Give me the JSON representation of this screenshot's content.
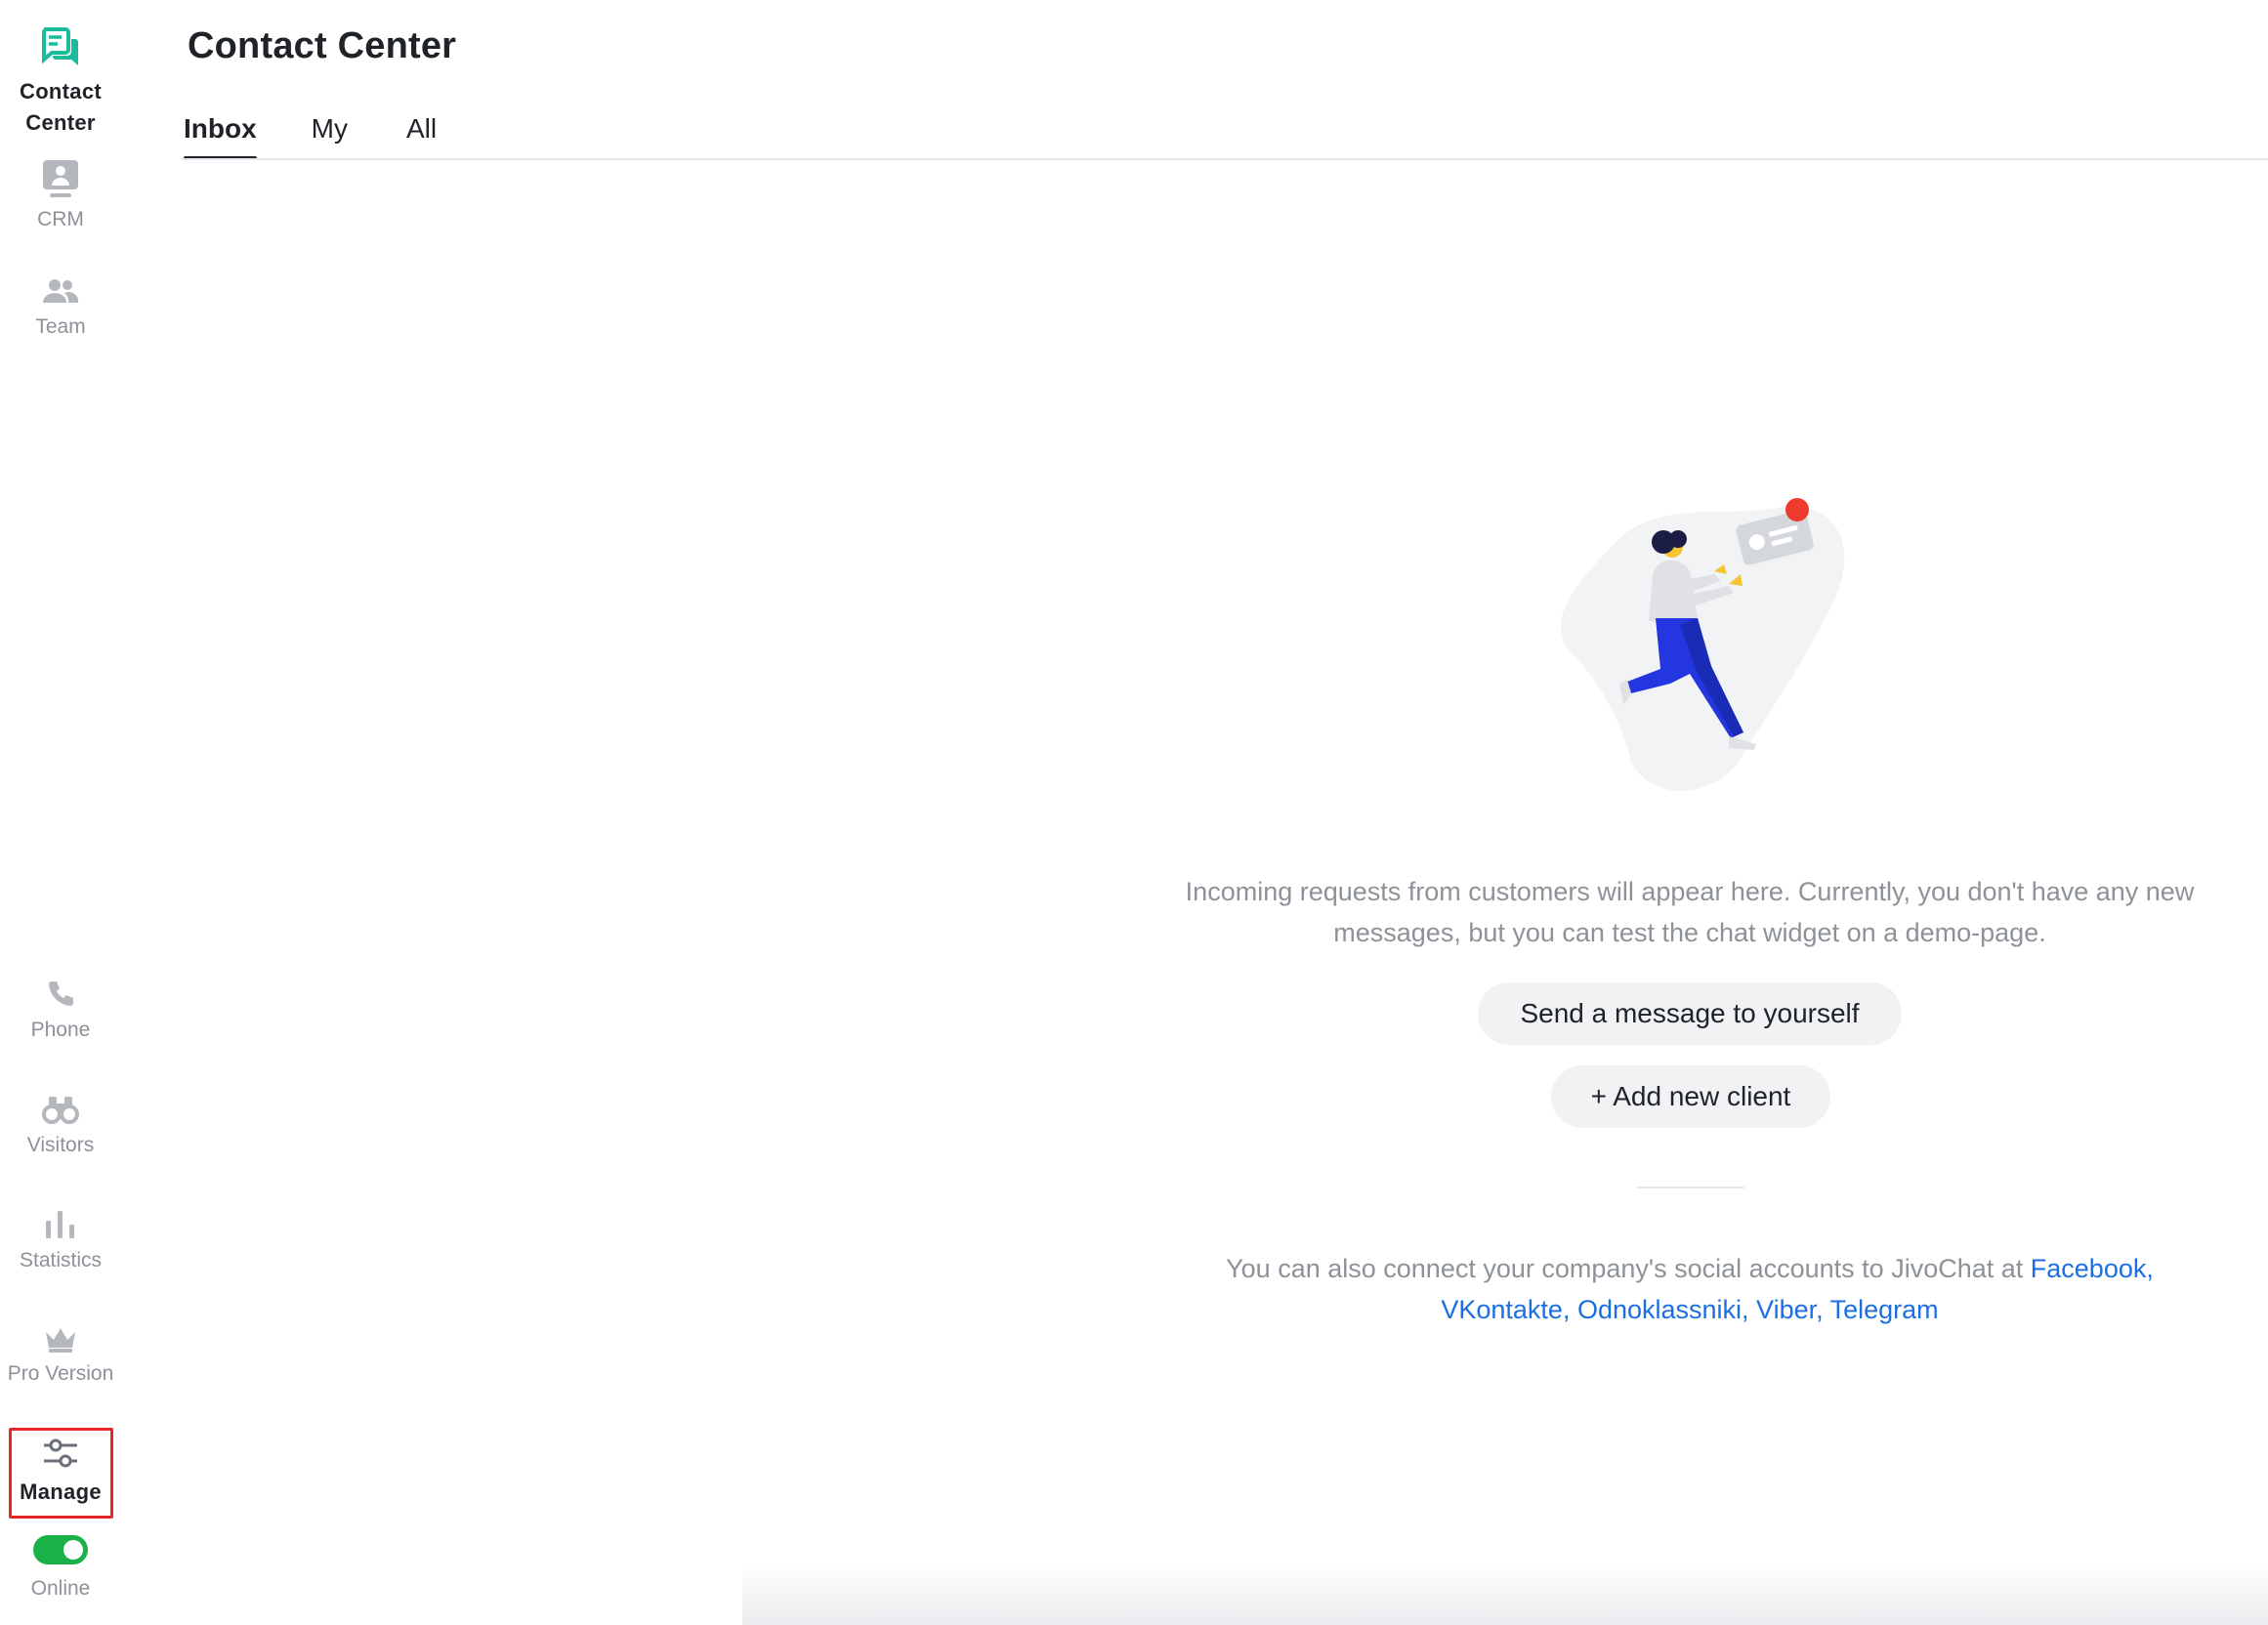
{
  "sidebar": {
    "contact_center": {
      "line1": "Contact",
      "line2": "Center",
      "icon": "chat-bubbles-icon",
      "color": "#1abc9c"
    },
    "crm": {
      "label": "CRM",
      "icon": "contact-card-icon"
    },
    "team": {
      "label": "Team",
      "icon": "people-icon"
    },
    "phone": {
      "label": "Phone",
      "icon": "phone-icon"
    },
    "visitors": {
      "label": "Visitors",
      "icon": "binoculars-icon"
    },
    "statistics": {
      "label": "Statistics",
      "icon": "bar-chart-icon"
    },
    "pro": {
      "label": "Pro Version",
      "icon": "crown-icon"
    },
    "manage": {
      "label": "Manage",
      "icon": "sliders-icon"
    },
    "online": {
      "label": "Online",
      "state": "on",
      "color": "#1ab248"
    }
  },
  "header": {
    "title": "Contact Center",
    "tabs": [
      {
        "label": "Inbox",
        "active": true
      },
      {
        "label": "My",
        "active": false
      },
      {
        "label": "All",
        "active": false
      }
    ]
  },
  "empty_state": {
    "illustration": "running-person-with-message-card",
    "message": "Incoming requests from customers will appear here. Currently, you don't have any new messages, but you can test the chat widget on a demo-page.",
    "send_button": "Send a message to yourself",
    "add_button": "+ Add new client",
    "social_prefix": "You can also connect your company's social accounts to JivoChat at",
    "social_links": [
      "Facebook,",
      "VKontakte,",
      "Odnoklassniki,",
      "Viber,",
      "Telegram"
    ],
    "link_color": "#1c6fe3"
  }
}
